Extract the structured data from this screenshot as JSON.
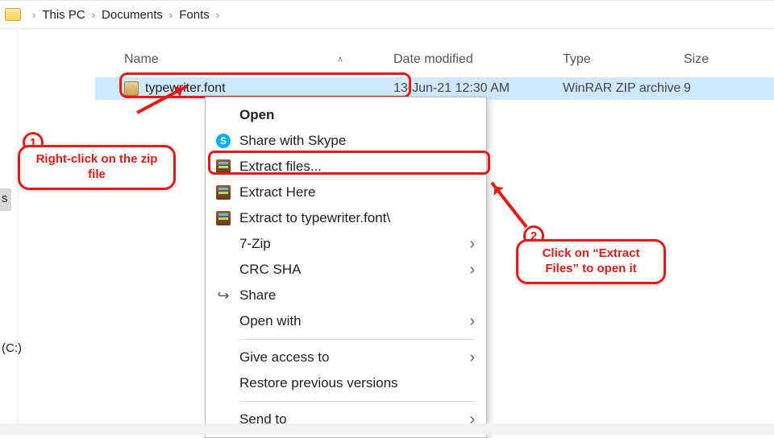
{
  "breadcrumb": {
    "items": [
      "This PC",
      "Documents",
      "Fonts"
    ]
  },
  "sidebar": {
    "sel_letter": "s",
    "drive_label": "(C:)"
  },
  "columns": {
    "name": "Name",
    "date": "Date modified",
    "type": "Type",
    "size": "Size"
  },
  "file": {
    "name": "typewriter.font",
    "date": "13-Jun-21 12:30 AM",
    "type": "WinRAR ZIP archive",
    "size": "9"
  },
  "menu": {
    "open": "Open",
    "skype": "Share with Skype",
    "extract_files": "Extract files...",
    "extract_here": "Extract Here",
    "extract_to": "Extract to typewriter.font\\",
    "sevenzip": "7-Zip",
    "crc": "CRC SHA",
    "share": "Share",
    "open_with": "Open with",
    "give_access": "Give access to",
    "restore": "Restore previous versions",
    "send_to": "Send to"
  },
  "callouts": {
    "c1_num": "1",
    "c1_text": "Right-click on the zip file",
    "c2_num": "2",
    "c2_text": "Click on “Extract Files” to open it"
  }
}
